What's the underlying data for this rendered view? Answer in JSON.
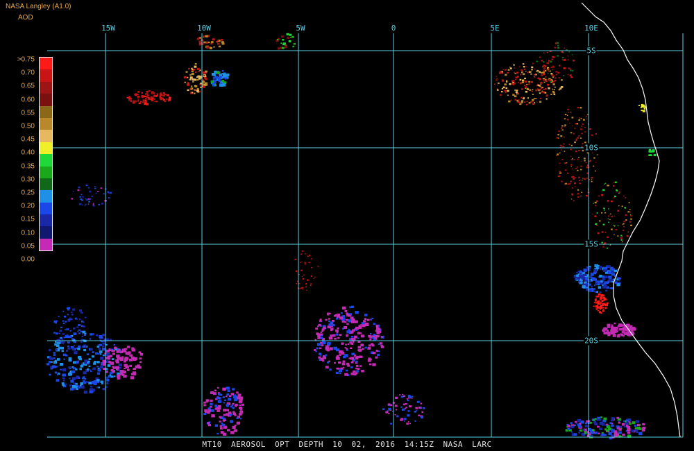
{
  "header": {
    "title": "NASA Langley (A1.0)",
    "subtitle": "AOD"
  },
  "grid": {
    "lon_labels": [
      "15W",
      "10W",
      "5W",
      "0",
      "5E",
      "10E"
    ],
    "lat_labels": [
      "5S",
      "10S",
      "15S",
      "20S"
    ]
  },
  "legend": {
    "labels": [
      ">0.75",
      "0.70",
      "0.65",
      "0.60",
      "0.55",
      "0.50",
      "0.45",
      "0.40",
      "0.35",
      "0.30",
      "0.25",
      "0.20",
      "0.15",
      "0.10",
      "0.05",
      "0.00"
    ],
    "colors": [
      "#ff1a1a",
      "#c81414",
      "#9c1414",
      "#7a1010",
      "#8a6818",
      "#b8882a",
      "#e8b860",
      "#f0f028",
      "#20d838",
      "#1aa81a",
      "#106818",
      "#1e90e8",
      "#1a48e8",
      "#1a28a8",
      "#101870",
      "#c42ab4"
    ]
  },
  "footer": {
    "text": "MT10  AEROSOL OPT DEPTH  10 02, 2016 14:15Z  NASA LARC"
  },
  "colors": {
    "grid": "#5bd2e6",
    "coast": "#ffffff",
    "label": "#e8a850",
    "background": "#000000"
  }
}
